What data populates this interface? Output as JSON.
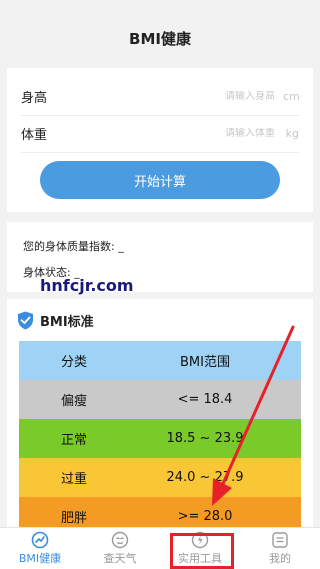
{
  "header": {
    "title": "BMI健康"
  },
  "form": {
    "height_label": "身高",
    "height_placeholder": "请输入身高",
    "height_unit": "cm",
    "weight_label": "体重",
    "weight_placeholder": "请输入体重",
    "weight_unit": "kg",
    "calc_button": "开始计算"
  },
  "result": {
    "bmi_label": "您的身体质量指数: _",
    "status_label": "身体状态: _"
  },
  "watermark": "hnfcjr.com",
  "standard": {
    "title": "BMI标准",
    "header": {
      "col1": "分类",
      "col2": "BMI范围",
      "color": "#9fd3f6"
    },
    "rows": [
      {
        "category": "偏瘦",
        "range": "<= 18.4",
        "color": "#c9c9c9"
      },
      {
        "category": "正常",
        "range": "18.5 ~ 23.9",
        "color": "#7acb2a"
      },
      {
        "category": "过重",
        "range": "24.0 ~ 27.9",
        "color": "#f9c735"
      },
      {
        "category": "肥胖",
        "range": ">= 28.0",
        "color": "#f49b24"
      }
    ]
  },
  "tabs": [
    {
      "label": "BMI健康",
      "icon": "bmi-icon",
      "active": true
    },
    {
      "label": "查天气",
      "icon": "weather-icon",
      "active": false
    },
    {
      "label": "实用工具",
      "icon": "tools-icon",
      "active": false
    },
    {
      "label": "我的",
      "icon": "profile-icon",
      "active": false
    }
  ],
  "colors": {
    "accent": "#3b8de0",
    "button": "#4a9be0",
    "annotation": "#e8202a"
  }
}
